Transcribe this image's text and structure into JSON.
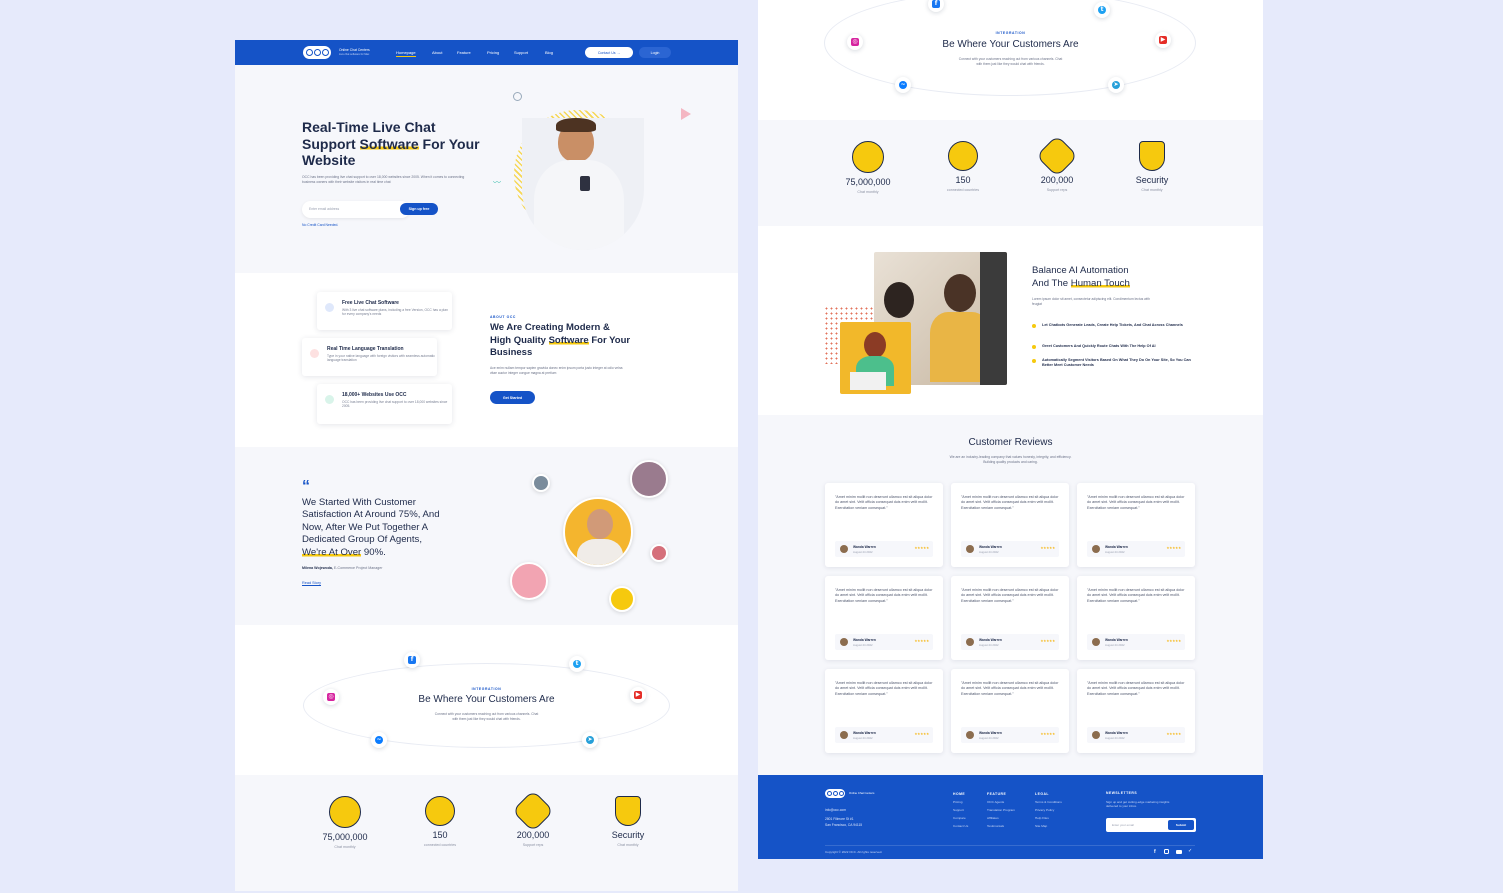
{
  "nav": {
    "logo_text": "OCC",
    "brand_name": "Online Chat Centers",
    "brand_tagline": "Live chat software for Max",
    "links": [
      "Homepage",
      "About",
      "Feature",
      "Pricing",
      "Support",
      "Blog"
    ],
    "contact_label": "Contact Us →",
    "login_label": "Login"
  },
  "hero": {
    "title_line1": "Real-Time Live Chat",
    "title_support": "Support ",
    "title_software": "Software",
    "title_rest": " For Your",
    "title_line3": "Website",
    "description": "OCC has been providing live chat support to over 18,000 websites since 2005. When it comes to connecting business owners with their website visitors in real time chat",
    "email_placeholder": "Enter email address",
    "signup_label": "Sign up free",
    "no_card_note": "No Credit Card Needed."
  },
  "features": {
    "cards": [
      {
        "title": "Free Live Chat Software",
        "desc": "With 3 live chat software plans, including a free Version, OCC has a plan for every company's needs"
      },
      {
        "title": "Real Time Language Translation",
        "desc": "Type in your native language with foreign visitors with seamless automatic language translation"
      },
      {
        "title": "18,000+ Websites Use OCC",
        "desc": "OCC has been providing live chat support to over 18,000 websites since 2005."
      }
    ],
    "about_label": "ABOUT OCC",
    "about_title_1": "We Are Creating Modern &",
    "about_title_2a": "High Quality ",
    "about_title_2b": "Software",
    "about_title_2c": " For Your",
    "about_title_3": "Business",
    "about_desc": "Ace enim nullam tempor sapien gravida donec enim ipsum porta justo integer at odio velna vitae auctor integer congue magna at pretium",
    "get_started_label": "Get Started"
  },
  "testimonial": {
    "quote_mark": "“",
    "quote_1": "We Started With Customer",
    "quote_2": "Satisfaction At Around 75%, And",
    "quote_3": "Now, After We Put Together A",
    "quote_4": "Dedicated Group Of Agents,",
    "quote_5a": "We're At Over",
    "quote_5b": " 90%.",
    "author": "Milena Wojewoda,",
    "author_role": " E-Commerce Project Manager",
    "read_story": "Read Story"
  },
  "integration": {
    "label": "INTEGRATION",
    "title": "Be Where Your Customers Are",
    "description_1": "Connect with your customers reaching out from various channels. Chat",
    "description_2": "with them just like they would chat with friends.",
    "channels": [
      "facebook-icon",
      "twitter-icon",
      "instagram-icon",
      "youtube-icon",
      "messenger-icon",
      "telegram-icon"
    ],
    "colors": {
      "facebook": "#1877f2",
      "twitter": "#1da1f2",
      "instagram": "#d6249f",
      "youtube": "#e52d27",
      "messenger": "#0a7cff",
      "telegram": "#27a0d9"
    }
  },
  "stats": [
    {
      "value": "75,000,000",
      "label": "Chat monthly"
    },
    {
      "value": "150",
      "label": "connected countries"
    },
    {
      "value": "200,000",
      "label": "Support reps"
    },
    {
      "value": "Security",
      "label": "Chat monthly"
    }
  ],
  "automation": {
    "title_1": "Balance AI Automation",
    "title_2a": "And The ",
    "title_2b": "Human Touch",
    "desc": "Lorem ipsum dolor sit amet, consectetur adipiscing elit. Condimentum lectus with feugiat",
    "bullets": [
      "Let Chatbots Generate Leads, Create Help Tickets, And Chat Across Channels",
      "Greet Customers And Quickly Route Chats With The Help Of AI",
      "Automatically Segment Visitors Based On What They Do On Your Site, So You Can Better Meet Customer Needs"
    ]
  },
  "reviews": {
    "title": "Customer Reviews",
    "subtitle_1": "We are an industry-leading company that values honesty, integrity, and efficiency.",
    "subtitle_2": "Building quality products and caring.",
    "quote": "\"Amet minim mollit non deserunt ullamco est sit aliqua dolor do amet sint. Velit officia consequat duis enim velit mollit. Exercitation veniam consequat.\"",
    "name": "Wanda Warren",
    "date": "August 24 2022",
    "stars": "★★★★★"
  },
  "footer": {
    "logo_text": "OCC",
    "brand_name": "Online Chat Centers",
    "email": "info@occ.com",
    "address_1": "2801 Fillmore St #1",
    "address_2": "San Francisco, CA 94115",
    "columns": [
      {
        "head": "HOME",
        "links": [
          "Pricing",
          "Support",
          "Compare",
          "Contact Us"
        ]
      },
      {
        "head": "FEATURE",
        "links": [
          "OCC Agents",
          "Translation Program",
          "Affiliates",
          "Testimonials"
        ]
      },
      {
        "head": "LEGAL",
        "links": [
          "Terms & Conditions",
          "Privacy Policy",
          "Help Files",
          "Site Map"
        ]
      }
    ],
    "newsletter_head": "NEWSLETTERS",
    "newsletter_desc": "Sign up and get cutting-edge marketing insights delivered to your inbox.",
    "newsletter_placeholder": "Enter your email",
    "submit_label": "Submit",
    "copyright": "Copyright © 2022 OCC. All rights reserved."
  },
  "colors": {
    "brand_blue": "#1553c7",
    "accent_yellow": "#f6c90e",
    "background": "#e6eafb"
  }
}
